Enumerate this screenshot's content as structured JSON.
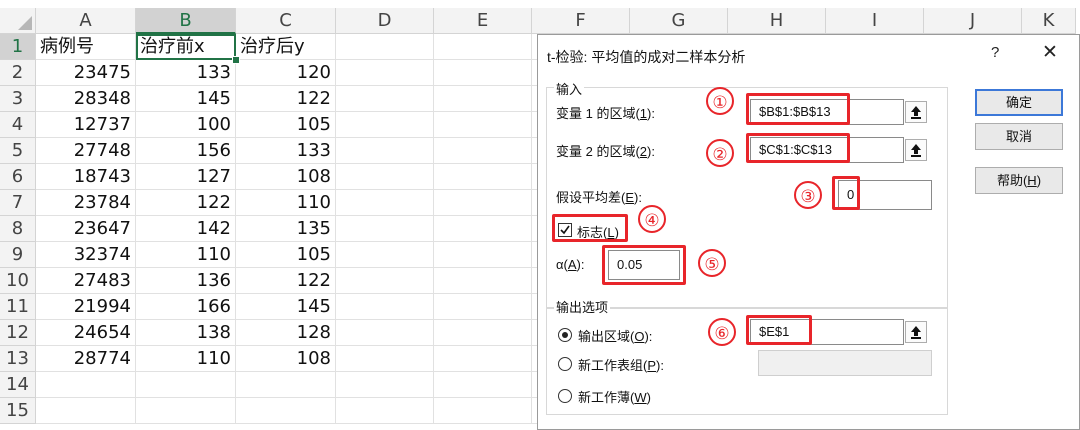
{
  "columns": [
    "A",
    "B",
    "C",
    "D",
    "E",
    "F",
    "G",
    "H",
    "I",
    "J",
    "K"
  ],
  "rows": [
    {
      "num": "1",
      "a": "病例号",
      "b": "治疗前x",
      "c": "治疗后y"
    },
    {
      "num": "2",
      "a": "23475",
      "b": "133",
      "c": "120"
    },
    {
      "num": "3",
      "a": "28348",
      "b": "145",
      "c": "122"
    },
    {
      "num": "4",
      "a": "12737",
      "b": "100",
      "c": "105"
    },
    {
      "num": "5",
      "a": "27748",
      "b": "156",
      "c": "133"
    },
    {
      "num": "6",
      "a": "18743",
      "b": "127",
      "c": "108"
    },
    {
      "num": "7",
      "a": "23784",
      "b": "122",
      "c": "110"
    },
    {
      "num": "8",
      "a": "23647",
      "b": "142",
      "c": "135"
    },
    {
      "num": "9",
      "a": "32374",
      "b": "110",
      "c": "105"
    },
    {
      "num": "10",
      "a": "27483",
      "b": "136",
      "c": "122"
    },
    {
      "num": "11",
      "a": "21994",
      "b": "166",
      "c": "145"
    },
    {
      "num": "12",
      "a": "24654",
      "b": "138",
      "c": "128"
    },
    {
      "num": "13",
      "a": "28774",
      "b": "110",
      "c": "108"
    },
    {
      "num": "14",
      "a": "",
      "b": "",
      "c": ""
    },
    {
      "num": "15",
      "a": "",
      "b": "",
      "c": ""
    }
  ],
  "dialog": {
    "title": "t-检验: 平均值的成对二样本分析",
    "help": "?",
    "close": "✕",
    "input_group": "输入",
    "var1_label": "变量 1 的区域(",
    "var1_key": "1",
    "var1_label_end": "):",
    "var1_value": "$B$1:$B$13",
    "var2_label": "变量 2 的区域(",
    "var2_key": "2",
    "var2_label_end": "):",
    "var2_value": "$C$1:$C$13",
    "hyp_label": "假设平均差(",
    "hyp_key": "E",
    "hyp_label_end": "):",
    "hyp_value": "0",
    "labels_text": "标志(",
    "labels_key": "L",
    "labels_end": ")",
    "labels_checked": true,
    "alpha_label": "α(",
    "alpha_key": "A",
    "alpha_label_end": "):",
    "alpha_value": "0.05",
    "output_group": "输出选项",
    "out_range_label": "输出区域(",
    "out_range_key": "O",
    "out_range_end": "):",
    "out_range_value": "$E$1",
    "new_sheet_label": "新工作表组(",
    "new_sheet_key": "P",
    "new_sheet_end": "):",
    "new_book_label": "新工作薄(",
    "new_book_key": "W",
    "new_book_end": ")",
    "ok": "确定",
    "cancel": "取消",
    "help_btn": "帮助(",
    "help_btn_key": "H",
    "help_btn_end": ")"
  },
  "annotations": [
    "①",
    "②",
    "③",
    "④",
    "⑤",
    "⑥"
  ]
}
